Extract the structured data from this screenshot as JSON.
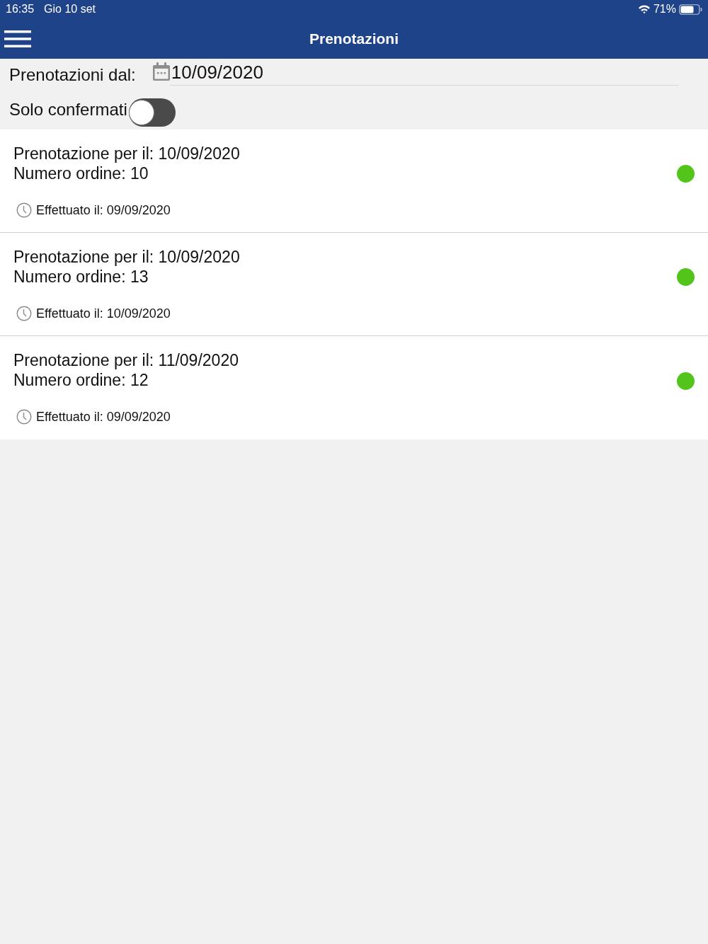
{
  "status_bar": {
    "time": "16:35",
    "date": "Gio 10 set",
    "battery": "71%"
  },
  "nav_bar": {
    "title": "Prenotazioni"
  },
  "filters": {
    "date_label": "Prenotazioni dal:",
    "date_value": "10/09/2020",
    "toggle_label": "Solo confermati",
    "toggle_on": false
  },
  "bookings": [
    {
      "date_line": "Prenotazione per il: 10/09/2020",
      "order_line": "Numero ordine: 10",
      "created": "Effettuato il: 09/09/2020",
      "color": "#52c41a"
    },
    {
      "date_line": "Prenotazione per il: 10/09/2020",
      "order_line": "Numero ordine: 13",
      "created": "Effettuato il: 10/09/2020",
      "color": "#52c41a"
    },
    {
      "date_line": "Prenotazione per il: 11/09/2020",
      "order_line": "Numero ordine: 12",
      "created": "Effettuato il: 09/09/2020",
      "color": "#52c41a"
    }
  ]
}
